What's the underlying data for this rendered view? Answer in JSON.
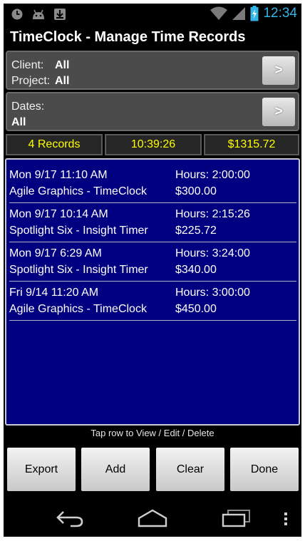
{
  "status_bar": {
    "time": "12:34",
    "icons": [
      "clock-icon",
      "android-icon",
      "download-icon",
      "wifi-icon",
      "signal-icon",
      "battery-charging-icon"
    ]
  },
  "app": {
    "title": "TimeClock - Manage Time Records"
  },
  "filters": {
    "client_label": "Client:",
    "client_value": "All",
    "project_label": "Project:",
    "project_value": "All",
    "client_button": ">",
    "dates_label": "Dates:",
    "dates_value": "All",
    "dates_button": ">"
  },
  "summary": {
    "records": "4 Records",
    "total_time": "10:39:26",
    "total_amount": "$1315.72",
    "text_color": "#ffff00"
  },
  "records": [
    {
      "date": "Mon 9/17 11:10 AM",
      "hours": "Hours: 2:00:00",
      "name": "Agile Graphics - TimeClock",
      "amount": "$300.00"
    },
    {
      "date": "Mon 9/17 10:14 AM",
      "hours": "Hours: 2:15:26",
      "name": "Spotlight Six - Insight Timer",
      "amount": "$225.72"
    },
    {
      "date": "Mon 9/17 6:29 AM",
      "hours": "Hours: 3:24:00",
      "name": "Spotlight Six - Insight Timer",
      "amount": "$340.00"
    },
    {
      "date": "Fri 9/14 11:20 AM",
      "hours": "Hours: 3:00:00",
      "name": "Agile Graphics - TimeClock",
      "amount": "$450.00"
    }
  ],
  "hint": "Tap row to View / Edit / Delete",
  "buttons": {
    "export": "Export",
    "add": "Add",
    "clear": "Clear",
    "done": "Done"
  },
  "nav": {
    "icons": [
      "back-icon",
      "home-icon",
      "recent-apps-icon",
      "overflow-menu-icon"
    ]
  },
  "colors": {
    "list_background": "#000080",
    "clock_accent": "#33b5e5"
  }
}
